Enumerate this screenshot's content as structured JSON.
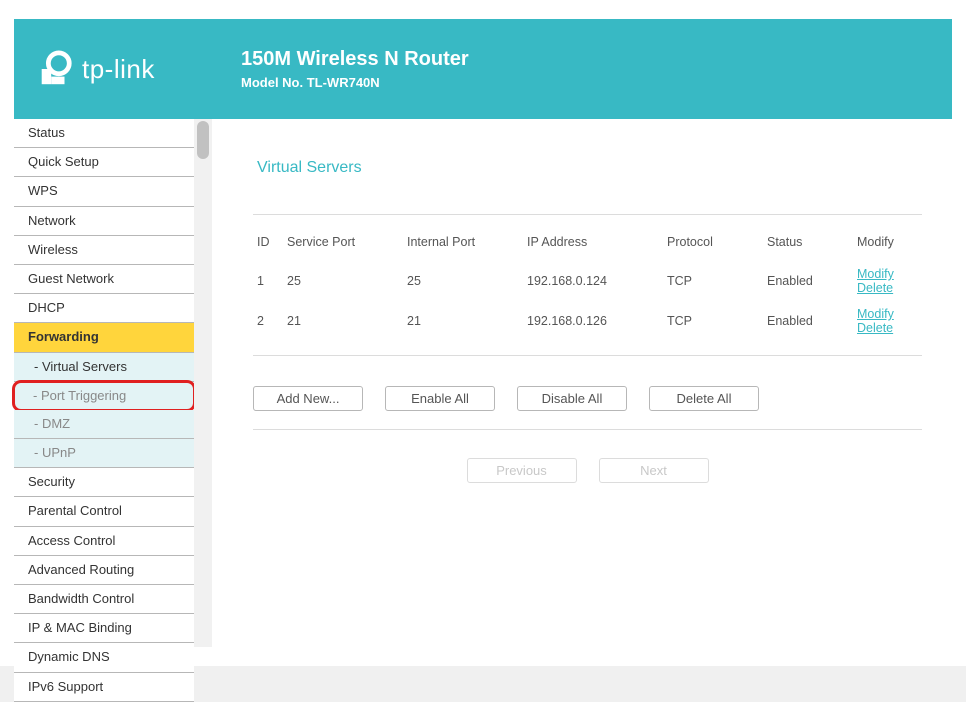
{
  "header": {
    "brand": "tp-link",
    "title": "150M Wireless N Router",
    "subtitle": "Model No. TL-WR740N"
  },
  "sidebar": {
    "items": [
      {
        "label": "Status",
        "type": "item"
      },
      {
        "label": "Quick Setup",
        "type": "item"
      },
      {
        "label": "WPS",
        "type": "item"
      },
      {
        "label": "Network",
        "type": "item"
      },
      {
        "label": "Wireless",
        "type": "item"
      },
      {
        "label": "Guest Network",
        "type": "item"
      },
      {
        "label": "DHCP",
        "type": "item"
      },
      {
        "label": "Forwarding",
        "type": "active"
      },
      {
        "label": "- Virtual Servers",
        "type": "sub-current"
      },
      {
        "label": "- Port Triggering",
        "type": "sub-highlight"
      },
      {
        "label": "- DMZ",
        "type": "sub"
      },
      {
        "label": "- UPnP",
        "type": "sub"
      },
      {
        "label": "Security",
        "type": "item"
      },
      {
        "label": "Parental Control",
        "type": "item"
      },
      {
        "label": "Access Control",
        "type": "item"
      },
      {
        "label": "Advanced Routing",
        "type": "item"
      },
      {
        "label": "Bandwidth Control",
        "type": "item"
      },
      {
        "label": "IP & MAC Binding",
        "type": "item"
      },
      {
        "label": "Dynamic DNS",
        "type": "item"
      },
      {
        "label": "IPv6 Support",
        "type": "item"
      }
    ]
  },
  "page": {
    "title": "Virtual Servers",
    "columns": {
      "id": "ID",
      "service_port": "Service Port",
      "internal_port": "Internal Port",
      "ip": "IP Address",
      "protocol": "Protocol",
      "status": "Status",
      "modify": "Modify"
    },
    "rows": [
      {
        "id": "1",
        "service_port": "25",
        "internal_port": "25",
        "ip": "192.168.0.124",
        "protocol": "TCP",
        "status": "Enabled"
      },
      {
        "id": "2",
        "service_port": "21",
        "internal_port": "21",
        "ip": "192.168.0.126",
        "protocol": "TCP",
        "status": "Enabled"
      }
    ],
    "links": {
      "modify": "Modify",
      "delete": "Delete"
    },
    "buttons": {
      "add": "Add New...",
      "enable_all": "Enable All",
      "disable_all": "Disable All",
      "delete_all": "Delete All",
      "previous": "Previous",
      "next": "Next"
    }
  }
}
